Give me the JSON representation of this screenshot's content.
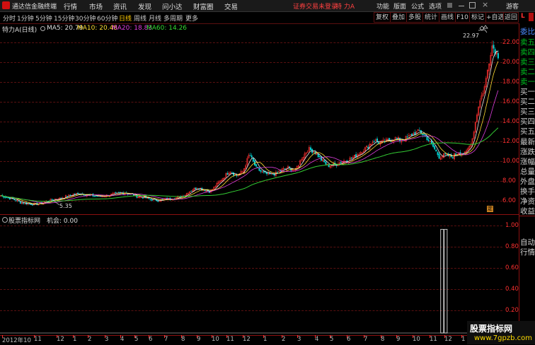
{
  "app": {
    "name": "通达信金融终端"
  },
  "menu": [
    "行情",
    "市场",
    "资讯",
    "发现",
    "问小达",
    "财富圈",
    "交易"
  ],
  "alert": "证券交易未登录",
  "stock_title": "特 力A",
  "top_right": [
    "功能",
    "版面",
    "公式",
    "选项",
    "游客"
  ],
  "subtabs": [
    "分时",
    "1分钟",
    "5分钟",
    "15分钟",
    "30分钟",
    "60分钟",
    "日线",
    "周线",
    "月线",
    "多周期",
    "更多"
  ],
  "active_subtab": "日线",
  "toolbar": [
    "复权",
    "叠加",
    "多股",
    "统计",
    "画线",
    "F10",
    "标记",
    "+自选",
    "返回"
  ],
  "legend": {
    "name": "特力A(日线)",
    "ma5": "MA5: 20.79",
    "ma10": "MA10: 20.48",
    "ma20": "MA20: 18.83",
    "ma60": "MA60: 14.26"
  },
  "right_panel": {
    "indicator": "L",
    "items": [
      "委比",
      "卖五",
      "卖四",
      "卖三",
      "卖二",
      "卖一",
      "买一",
      "买二",
      "买三",
      "买四",
      "买五",
      "最新",
      "涨跌",
      "涨幅",
      "总量",
      "外盘",
      "换手",
      "净资",
      "收益"
    ],
    "bottom": [
      "自动",
      "行情"
    ]
  },
  "price_axis": [
    "22.00",
    "20.00",
    "18.00",
    "16.00",
    "14.00",
    "12.00",
    "10.00",
    "8.00",
    "6.00"
  ],
  "annotations": {
    "high": "22.97",
    "low": "5.35"
  },
  "indicator": {
    "name": "股票指标网",
    "value_label": "机会: 0.00"
  },
  "indicator_axis": [
    "1.00",
    "0.80",
    "0.60",
    "0.40",
    "0.20"
  ],
  "time_axis": [
    "2012年10",
    "11",
    "12",
    "1",
    "2",
    "3",
    "4",
    "5",
    "6",
    "7",
    "8",
    "9",
    "10",
    "11",
    "12",
    "1",
    "2",
    "3",
    "4",
    "5",
    "6",
    "7",
    "8",
    "9",
    "10",
    "11",
    "12",
    "1",
    "2"
  ],
  "watermark": {
    "title": "股票指标网",
    "url": "www.7gpzb.com"
  },
  "chart_data": {
    "type": "candlestick",
    "ylim": [
      4.8,
      23.5
    ],
    "close": [
      6.4,
      6.2,
      6.0,
      5.7,
      5.6,
      5.5,
      5.6,
      5.8,
      6.0,
      6.1,
      6.3,
      6.5,
      6.6,
      6.5,
      6.4,
      6.3,
      6.4,
      6.5,
      6.6,
      6.7,
      6.5,
      6.3,
      6.2,
      6.0,
      5.9,
      6.0,
      6.1,
      6.2,
      6.4,
      6.9,
      7.2,
      7.0,
      6.8,
      7.5,
      8.2,
      8.9,
      8.4,
      8.8,
      10.6,
      9.2,
      8.7,
      8.5,
      8.6,
      9.0,
      9.2,
      8.9,
      10.2,
      11.1,
      10.8,
      10.0,
      9.4,
      9.5,
      9.8,
      10.0,
      10.3,
      10.8,
      11.3,
      12.0,
      11.7,
      11.9,
      12.2,
      12.0,
      12.2,
      12.6,
      12.9,
      12.3,
      11.4,
      10.3,
      10.5,
      10.3,
      10.8,
      10.6,
      11.9,
      15.5,
      17.5,
      21.6,
      20.6
    ],
    "ma20_last": 18.83,
    "ma60_last": 14.26,
    "signal": {
      "spikes_at": [
        0.85,
        0.857
      ],
      "value": 1.0
    }
  }
}
